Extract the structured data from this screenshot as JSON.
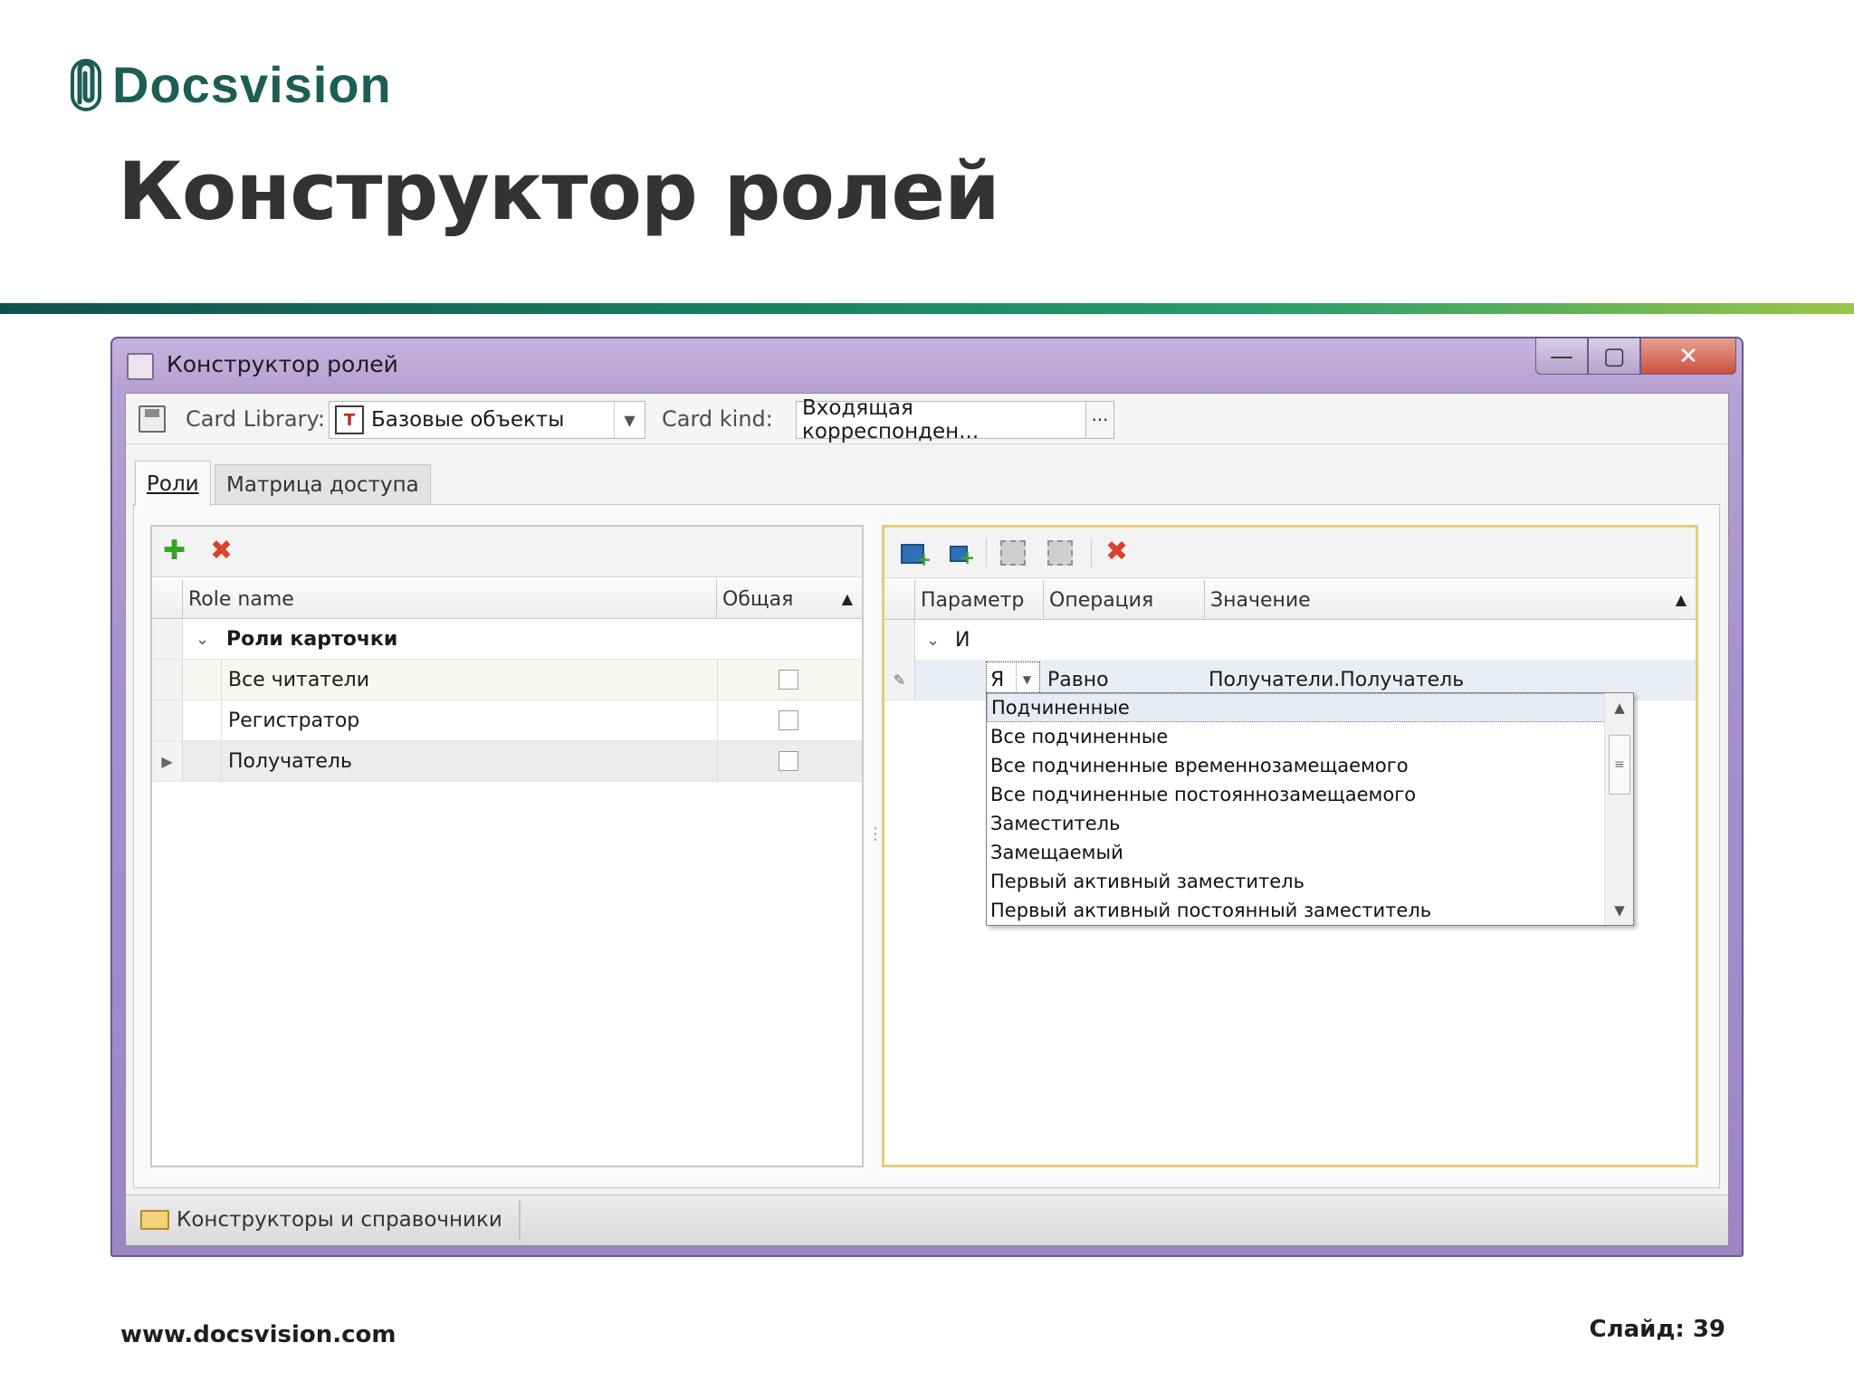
{
  "brand": {
    "name": "Docsvision",
    "color": "#1c5e55"
  },
  "slide": {
    "title": "Конструктор ролей",
    "url": "www.docsvision.com",
    "number": "Слайд: 39"
  },
  "window": {
    "title": "Конструктор ролей",
    "buttons": {
      "minimize": "—",
      "maximize": "▢",
      "close": "✕"
    }
  },
  "toolbar": {
    "card_library_label": "Card Library:",
    "card_library_value": "Базовые объекты",
    "card_kind_label": "Card kind:",
    "card_kind_value": "Входящая корреспонден...",
    "dots": "···"
  },
  "tabs": [
    {
      "label": "Роли",
      "active": true
    },
    {
      "label": "Матрица доступа",
      "active": false
    }
  ],
  "roles_grid": {
    "columns": [
      "Role name",
      "Общая"
    ],
    "group_label": "Роли карточки",
    "rows": [
      {
        "name": "Все читатели",
        "shared": false
      },
      {
        "name": "Регистратор",
        "shared": false
      },
      {
        "name": "Получатель",
        "shared": false,
        "current": true
      }
    ]
  },
  "conditions_grid": {
    "columns": [
      "Параметр",
      "Операция",
      "Значение"
    ],
    "group_label": "И",
    "edit_row": {
      "parameter": "Я",
      "operation": "Равно",
      "value": "Получатели.Получатель"
    }
  },
  "dropdown": {
    "items": [
      "Подчиненные",
      "Все подчиненные",
      "Все подчиненные временнозамещаемого",
      "Все подчиненные постояннозамещаемого",
      "Заместитель",
      "Замещаемый",
      "Первый активный заместитель",
      "Первый активный постоянный заместитель"
    ],
    "selected_index": 0
  },
  "status_bar": {
    "text": "Конструкторы и справочники"
  }
}
